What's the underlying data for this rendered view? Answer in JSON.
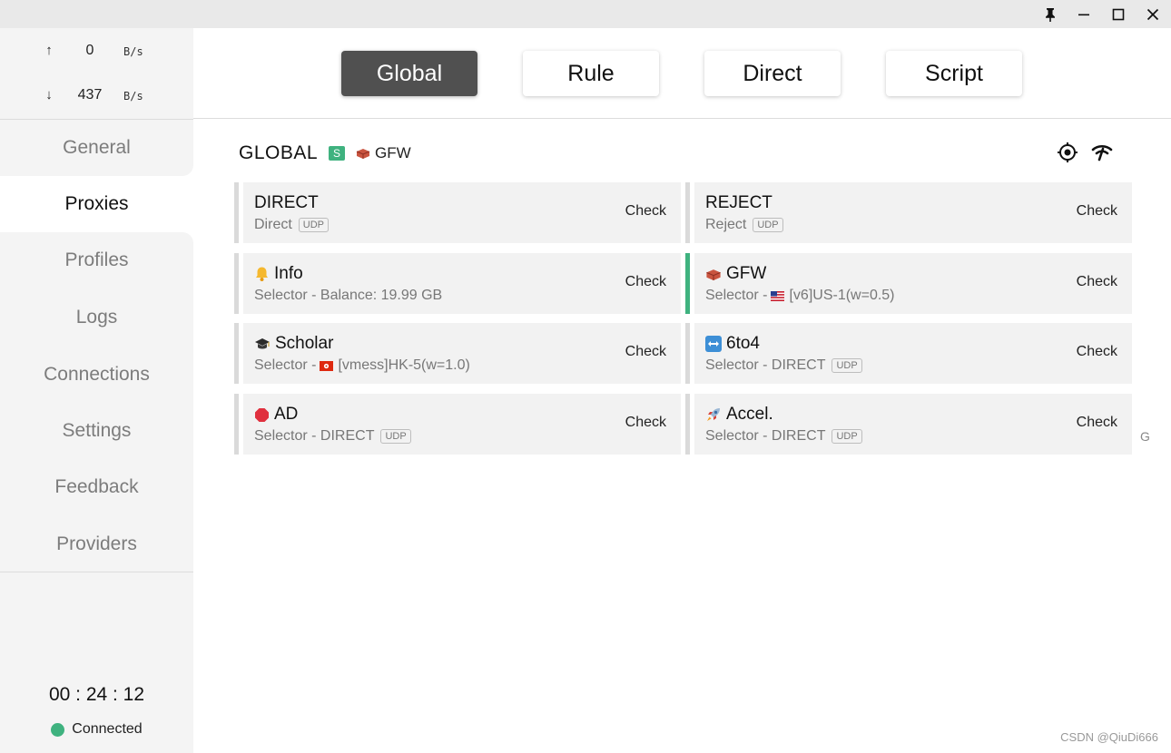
{
  "window": {
    "pin_icon": "pin-icon",
    "minimize_icon": "minimize-icon",
    "maximize_icon": "maximize-icon",
    "close_icon": "close-icon"
  },
  "traffic": {
    "up_arrow": "↑",
    "up_value": "0",
    "up_unit": "B/s",
    "down_arrow": "↓",
    "down_value": "437",
    "down_unit": "B/s"
  },
  "nav": {
    "items": [
      {
        "label": "General"
      },
      {
        "label": "Proxies"
      },
      {
        "label": "Profiles"
      },
      {
        "label": "Logs"
      },
      {
        "label": "Connections"
      },
      {
        "label": "Settings"
      },
      {
        "label": "Feedback"
      },
      {
        "label": "Providers"
      }
    ],
    "active": "Proxies"
  },
  "status": {
    "uptime": "00 : 24 : 12",
    "connection": "Connected",
    "dot_color": "#3fb27f"
  },
  "modes": {
    "items": [
      {
        "label": "Global"
      },
      {
        "label": "Rule"
      },
      {
        "label": "Direct"
      },
      {
        "label": "Script"
      }
    ],
    "active": "Global"
  },
  "group": {
    "name": "GLOBAL",
    "badge": "S",
    "selected": "GFW",
    "selected_icon": "brick-icon",
    "locate_icon": "locate-icon",
    "speedtest_icon": "wifi-speed-icon"
  },
  "proxies": [
    {
      "name": "DIRECT",
      "icon": "",
      "sub": "Direct",
      "sub_flag": "",
      "udp": "UDP",
      "check": "Check",
      "selected": false
    },
    {
      "name": "REJECT",
      "icon": "",
      "sub": "Reject",
      "sub_flag": "",
      "udp": "UDP",
      "check": "Check",
      "selected": false
    },
    {
      "name": "Info",
      "icon": "bell-icon",
      "sub": "Selector - Balance: 19.99 GB",
      "sub_flag": "",
      "udp": "",
      "check": "Check",
      "selected": false
    },
    {
      "name": "GFW",
      "icon": "brick-icon",
      "sub": "Selector - ",
      "sub_flag": "us-flag-icon",
      "sub_after": "[v6]US-1(w=0.5)",
      "udp": "",
      "check": "Check",
      "selected": true
    },
    {
      "name": "Scholar",
      "icon": "graduation-cap-icon",
      "sub": "Selector - ",
      "sub_flag": "hk-flag-icon",
      "sub_after": "[vmess]HK-5(w=1.0)",
      "udp": "",
      "check": "Check",
      "selected": false
    },
    {
      "name": "6to4",
      "icon": "left-right-arrow-icon",
      "sub": "Selector - DIRECT",
      "sub_flag": "",
      "udp": "UDP",
      "check": "Check",
      "selected": false
    },
    {
      "name": "AD",
      "icon": "stop-sign-icon",
      "sub": "Selector - DIRECT",
      "sub_flag": "",
      "udp": "UDP",
      "check": "Check",
      "selected": false
    },
    {
      "name": "Accel.",
      "icon": "rocket-icon",
      "sub": "Selector - DIRECT",
      "sub_flag": "",
      "udp": "UDP",
      "check": "Check",
      "selected": false
    }
  ],
  "side_letter": "G",
  "watermark": "CSDN @QiuDi666"
}
